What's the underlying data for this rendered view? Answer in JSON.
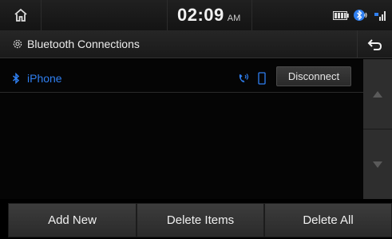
{
  "status": {
    "time": "02:09",
    "ampm": "AM",
    "home_icon": "home-icon",
    "battery_icon": "battery-icon",
    "bluetooth_audio_icon": "bluetooth-audio-icon",
    "signal_icon": "signal-icon"
  },
  "header": {
    "title": "Bluetooth Connections",
    "settings_icon": "gear-icon",
    "back_icon": "back-arrow-icon"
  },
  "devices": [
    {
      "name": "iPhone",
      "connected": true,
      "action_label": "Disconnect",
      "features": [
        "call-audio-icon",
        "phone-icon"
      ]
    }
  ],
  "footer": {
    "add_new": "Add New",
    "delete_items": "Delete Items",
    "delete_all": "Delete All"
  },
  "colors": {
    "accent": "#2f7ff0",
    "bluetooth": "#3a8dff"
  }
}
